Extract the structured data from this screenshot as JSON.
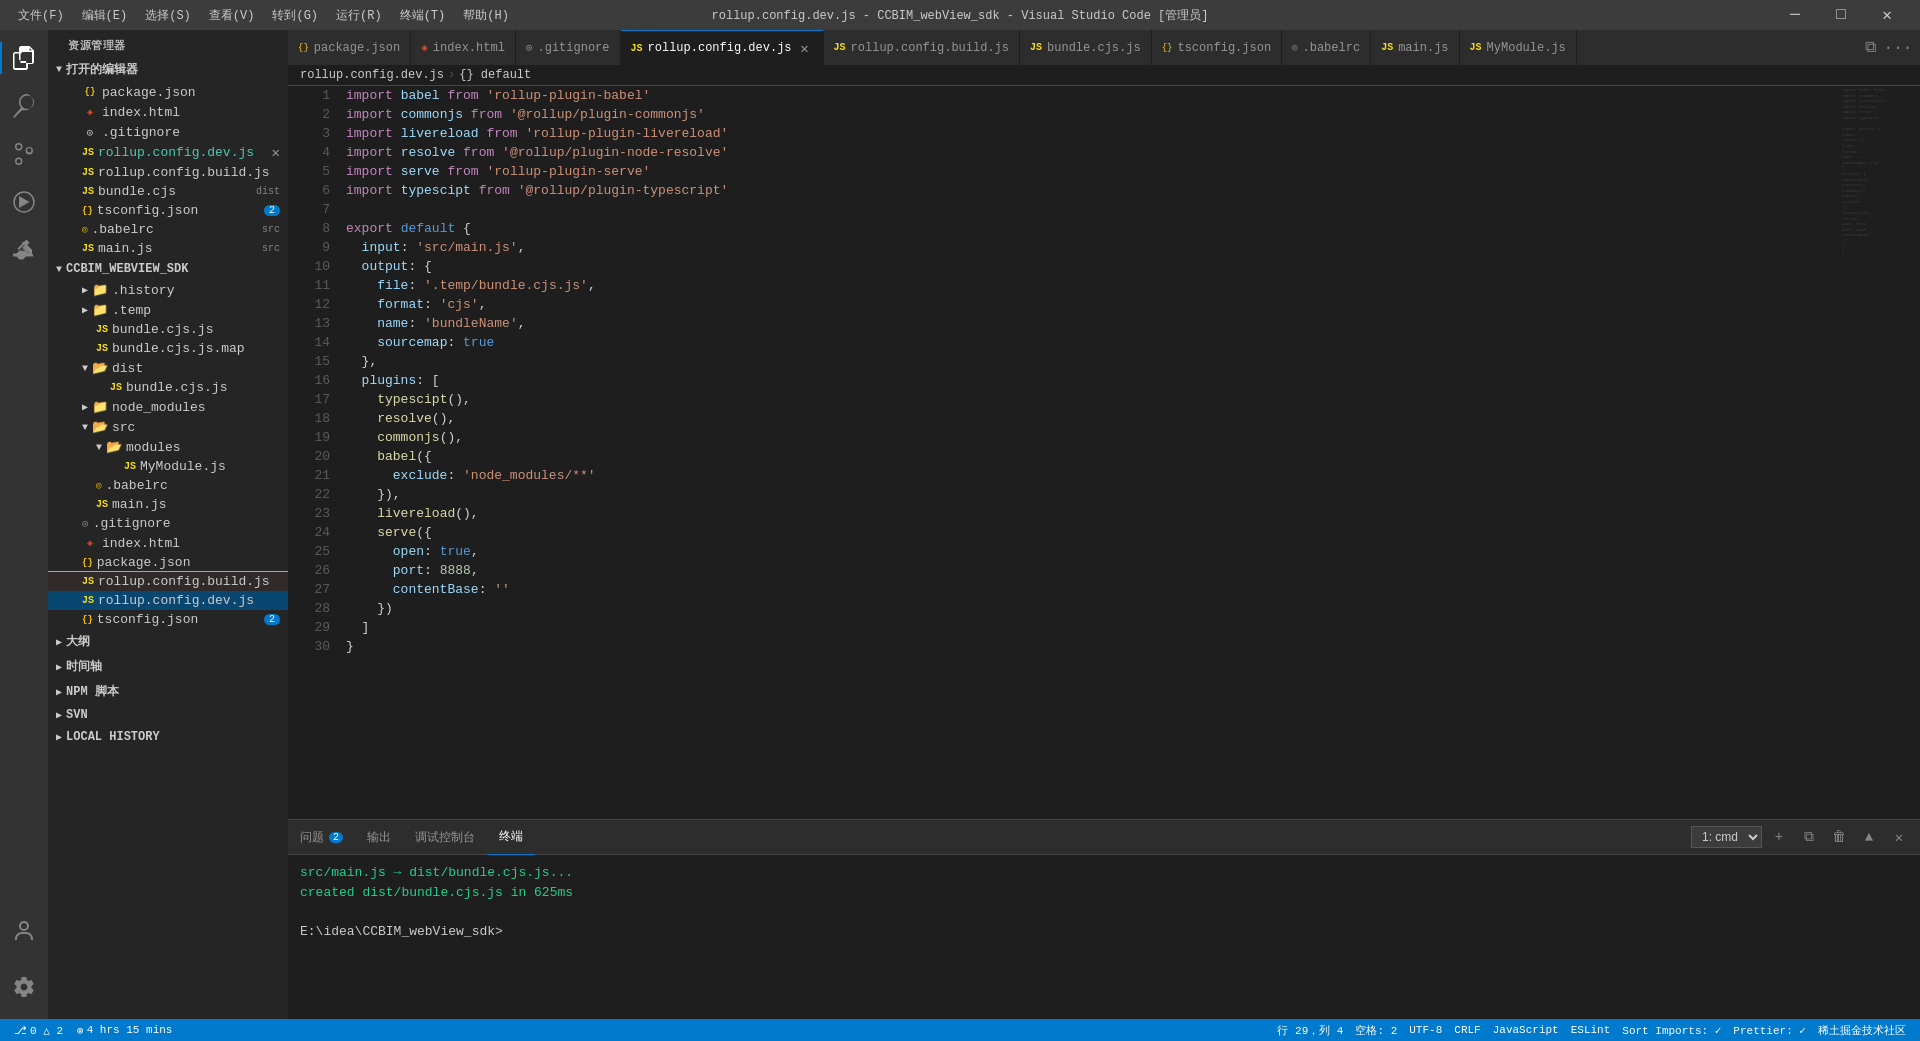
{
  "titleBar": {
    "title": "rollup.config.dev.js - CCBIM_webView_sdk - Visual Studio Code [管理员]",
    "menus": [
      "文件(F)",
      "编辑(E)",
      "选择(S)",
      "查看(V)",
      "转到(G)",
      "运行(R)",
      "终端(T)",
      "帮助(H)"
    ],
    "controls": [
      "─",
      "□",
      "✕"
    ]
  },
  "activityBar": {
    "icons": [
      "explorer",
      "search",
      "source-control",
      "run-debug",
      "extensions"
    ]
  },
  "sidebar": {
    "title": "资源管理器",
    "sections": [
      {
        "name": "打开的编辑器",
        "items": [
          {
            "name": "package.json",
            "type": "json",
            "indent": 1
          },
          {
            "name": "index.html",
            "type": "html",
            "indent": 1
          },
          {
            "name": ".gitignore",
            "type": "git",
            "indent": 1
          },
          {
            "name": "rollup.config.dev.js",
            "type": "js",
            "indent": 1,
            "active": true,
            "closing": true
          },
          {
            "name": "rollup.config.build.js",
            "type": "js",
            "indent": 1
          },
          {
            "name": "bundle.cjs",
            "type": "js",
            "indent": 1,
            "tag": "dist"
          },
          {
            "name": "tsconfig.json",
            "type": "ts",
            "indent": 1,
            "badge": "2"
          },
          {
            "name": ".babelrc",
            "type": "json",
            "indent": 1,
            "tag": "src"
          },
          {
            "name": "main.js",
            "type": "js",
            "indent": 1,
            "tag": "src"
          }
        ]
      },
      {
        "name": "CCBIM_WEBVIEW_SDK",
        "items": [
          {
            "name": ".history",
            "type": "folder",
            "indent": 1,
            "expanded": false
          },
          {
            "name": ".temp",
            "type": "folder",
            "indent": 1,
            "expanded": false
          },
          {
            "name": "bundle.cjs.js",
            "type": "js",
            "indent": 2
          },
          {
            "name": "bundle.cjs.js.map",
            "type": "js",
            "indent": 2
          },
          {
            "name": "dist",
            "type": "folder",
            "indent": 1,
            "expanded": true
          },
          {
            "name": "bundle.cjs.js",
            "type": "js",
            "indent": 3
          },
          {
            "name": "node_modules",
            "type": "folder",
            "indent": 1,
            "expanded": false
          },
          {
            "name": "src",
            "type": "folder",
            "indent": 1,
            "expanded": true
          },
          {
            "name": "modules",
            "type": "folder",
            "indent": 2,
            "expanded": true
          },
          {
            "name": "MyModule.js",
            "type": "js",
            "indent": 4
          },
          {
            "name": ".babelrc",
            "type": "json",
            "indent": 2
          },
          {
            "name": "main.js",
            "type": "js",
            "indent": 2
          },
          {
            "name": ".gitignore",
            "type": "git",
            "indent": 1
          },
          {
            "name": "index.html",
            "type": "html",
            "indent": 1
          },
          {
            "name": "package.json",
            "type": "json",
            "indent": 1
          },
          {
            "name": "rollup.config.build.js",
            "type": "js",
            "indent": 1,
            "redBorder": true
          },
          {
            "name": "rollup.config.dev.js",
            "type": "js",
            "indent": 1,
            "blueHighlight": true
          },
          {
            "name": "tsconfig.json",
            "type": "json",
            "indent": 1,
            "badge": "2"
          }
        ]
      }
    ],
    "bottomSections": [
      "大纲",
      "时间轴",
      "NPM 脚本",
      "SVN",
      "LOCAL HISTORY"
    ]
  },
  "tabs": [
    {
      "label": "package.json",
      "type": "json",
      "active": false
    },
    {
      "label": "index.html",
      "type": "html",
      "active": false
    },
    {
      "label": ".gitignore",
      "type": "git",
      "active": false
    },
    {
      "label": "rollup.config.dev.js",
      "type": "js",
      "active": true
    },
    {
      "label": "rollup.config.build.js",
      "type": "js",
      "active": false
    },
    {
      "label": "bundle.cjs.js",
      "type": "js",
      "active": false
    },
    {
      "label": "tsconfig.json",
      "type": "ts",
      "active": false
    },
    {
      "label": ".babelrc",
      "type": "json",
      "active": false
    },
    {
      "label": "main.js",
      "type": "js",
      "active": false
    },
    {
      "label": "MyModule.js",
      "type": "js",
      "active": false
    }
  ],
  "breadcrumb": {
    "parts": [
      "rollup.config.dev.js",
      "{} default"
    ]
  },
  "codeLines": [
    {
      "num": 1,
      "text": "import babel from 'rollup-plugin-babel'"
    },
    {
      "num": 2,
      "text": "import commonjs from '@rollup/plugin-commonjs'"
    },
    {
      "num": 3,
      "text": "import livereload from 'rollup-plugin-livereload'"
    },
    {
      "num": 4,
      "text": "import resolve from '@rollup/plugin-node-resolve'"
    },
    {
      "num": 5,
      "text": "import serve from 'rollup-plugin-serve'"
    },
    {
      "num": 6,
      "text": "import typescipt from '@rollup/plugin-typescript'"
    },
    {
      "num": 7,
      "text": ""
    },
    {
      "num": 8,
      "text": "export default {"
    },
    {
      "num": 9,
      "text": "  input: 'src/main.js',"
    },
    {
      "num": 10,
      "text": "  output: {"
    },
    {
      "num": 11,
      "text": "    file: '.temp/bundle.cjs.js',"
    },
    {
      "num": 12,
      "text": "    format: 'cjs',"
    },
    {
      "num": 13,
      "text": "    name: 'bundleName',"
    },
    {
      "num": 14,
      "text": "    sourcemap: true"
    },
    {
      "num": 15,
      "text": "  },"
    },
    {
      "num": 16,
      "text": "  plugins: ["
    },
    {
      "num": 17,
      "text": "    typescipt(),"
    },
    {
      "num": 18,
      "text": "    resolve(),"
    },
    {
      "num": 19,
      "text": "    commonjs(),"
    },
    {
      "num": 20,
      "text": "    babel({"
    },
    {
      "num": 21,
      "text": "      exclude: 'node_modules/**'"
    },
    {
      "num": 22,
      "text": "    }),"
    },
    {
      "num": 23,
      "text": "    livereload(),"
    },
    {
      "num": 24,
      "text": "    serve({"
    },
    {
      "num": 25,
      "text": "      open: true,"
    },
    {
      "num": 26,
      "text": "      port: 8888,"
    },
    {
      "num": 27,
      "text": "      contentBase: ''"
    },
    {
      "num": 28,
      "text": "    })"
    },
    {
      "num": 29,
      "text": "  ]"
    },
    {
      "num": 30,
      "text": "}"
    }
  ],
  "panel": {
    "tabs": [
      {
        "label": "问题",
        "badge": "2"
      },
      {
        "label": "输出"
      },
      {
        "label": "调试控制台"
      },
      {
        "label": "终端",
        "active": true
      }
    ],
    "terminalDropdown": "1: cmd",
    "lines": [
      {
        "text": "src/main.js → dist/bundle.cjs.js...",
        "type": "success"
      },
      {
        "text": "created dist/bundle.cjs.js in 625ms",
        "type": "success"
      },
      {
        "text": ""
      },
      {
        "text": "E:\\idea\\CCBIM_webView_sdk>",
        "type": "prompt"
      }
    ]
  },
  "statusBar": {
    "left": [
      {
        "icon": "⎇",
        "text": "0 △ 2"
      },
      {
        "text": "⊗ 4 hrs 15 mins"
      }
    ],
    "right": [
      {
        "text": "行 29，列 4"
      },
      {
        "text": "空格: 2"
      },
      {
        "text": "UTF-8"
      },
      {
        "text": "CRLF"
      },
      {
        "text": "JavaScript"
      },
      {
        "text": "ESLint"
      },
      {
        "text": "Sort Imports: ✓"
      },
      {
        "text": "Prettier: ✓"
      },
      {
        "text": "稀土掘金技术社区"
      }
    ]
  }
}
